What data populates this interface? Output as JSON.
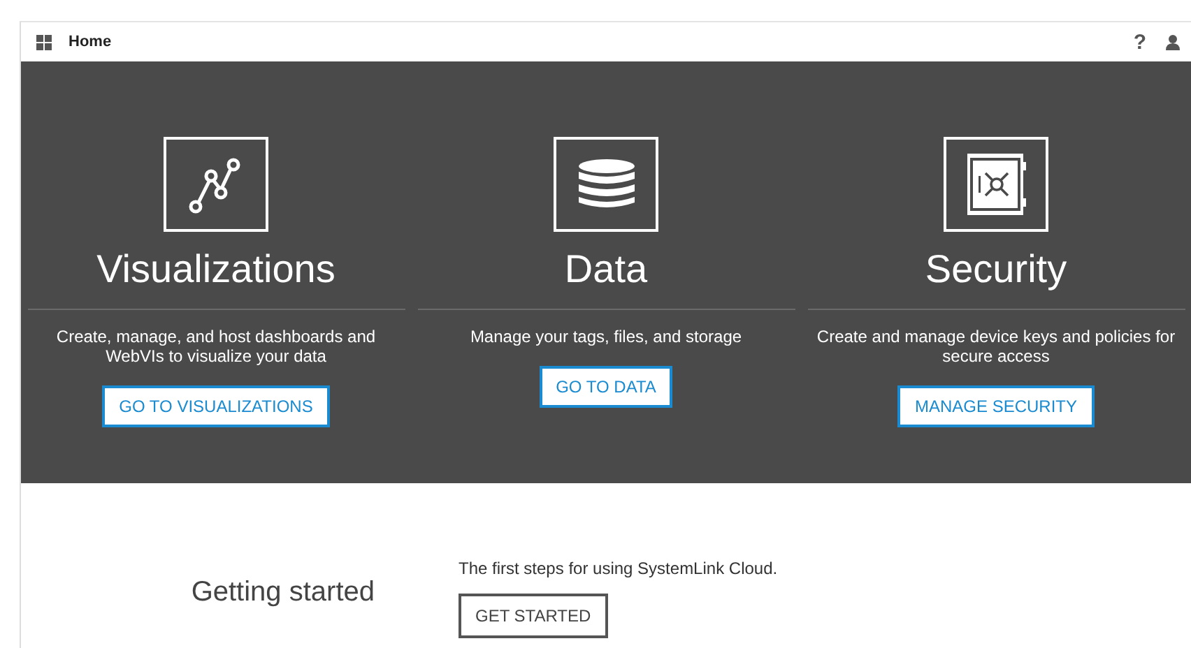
{
  "header": {
    "title": "Home",
    "help": "?"
  },
  "features": [
    {
      "kind": "chart",
      "title": "Visualizations",
      "description": "Create, manage, and host dashboards and WebVIs to visualize your data",
      "button": "GO TO VISUALIZATIONS"
    },
    {
      "kind": "database",
      "title": "Data",
      "description": "Manage your tags, files, and storage",
      "button": "GO TO DATA"
    },
    {
      "kind": "safe",
      "title": "Security",
      "description": "Create and manage device keys and policies for secure access",
      "button": "MANAGE SECURITY"
    }
  ],
  "getting_started": {
    "title": "Getting started",
    "description": "The first steps for using SystemLink Cloud.",
    "button": "GET STARTED"
  }
}
